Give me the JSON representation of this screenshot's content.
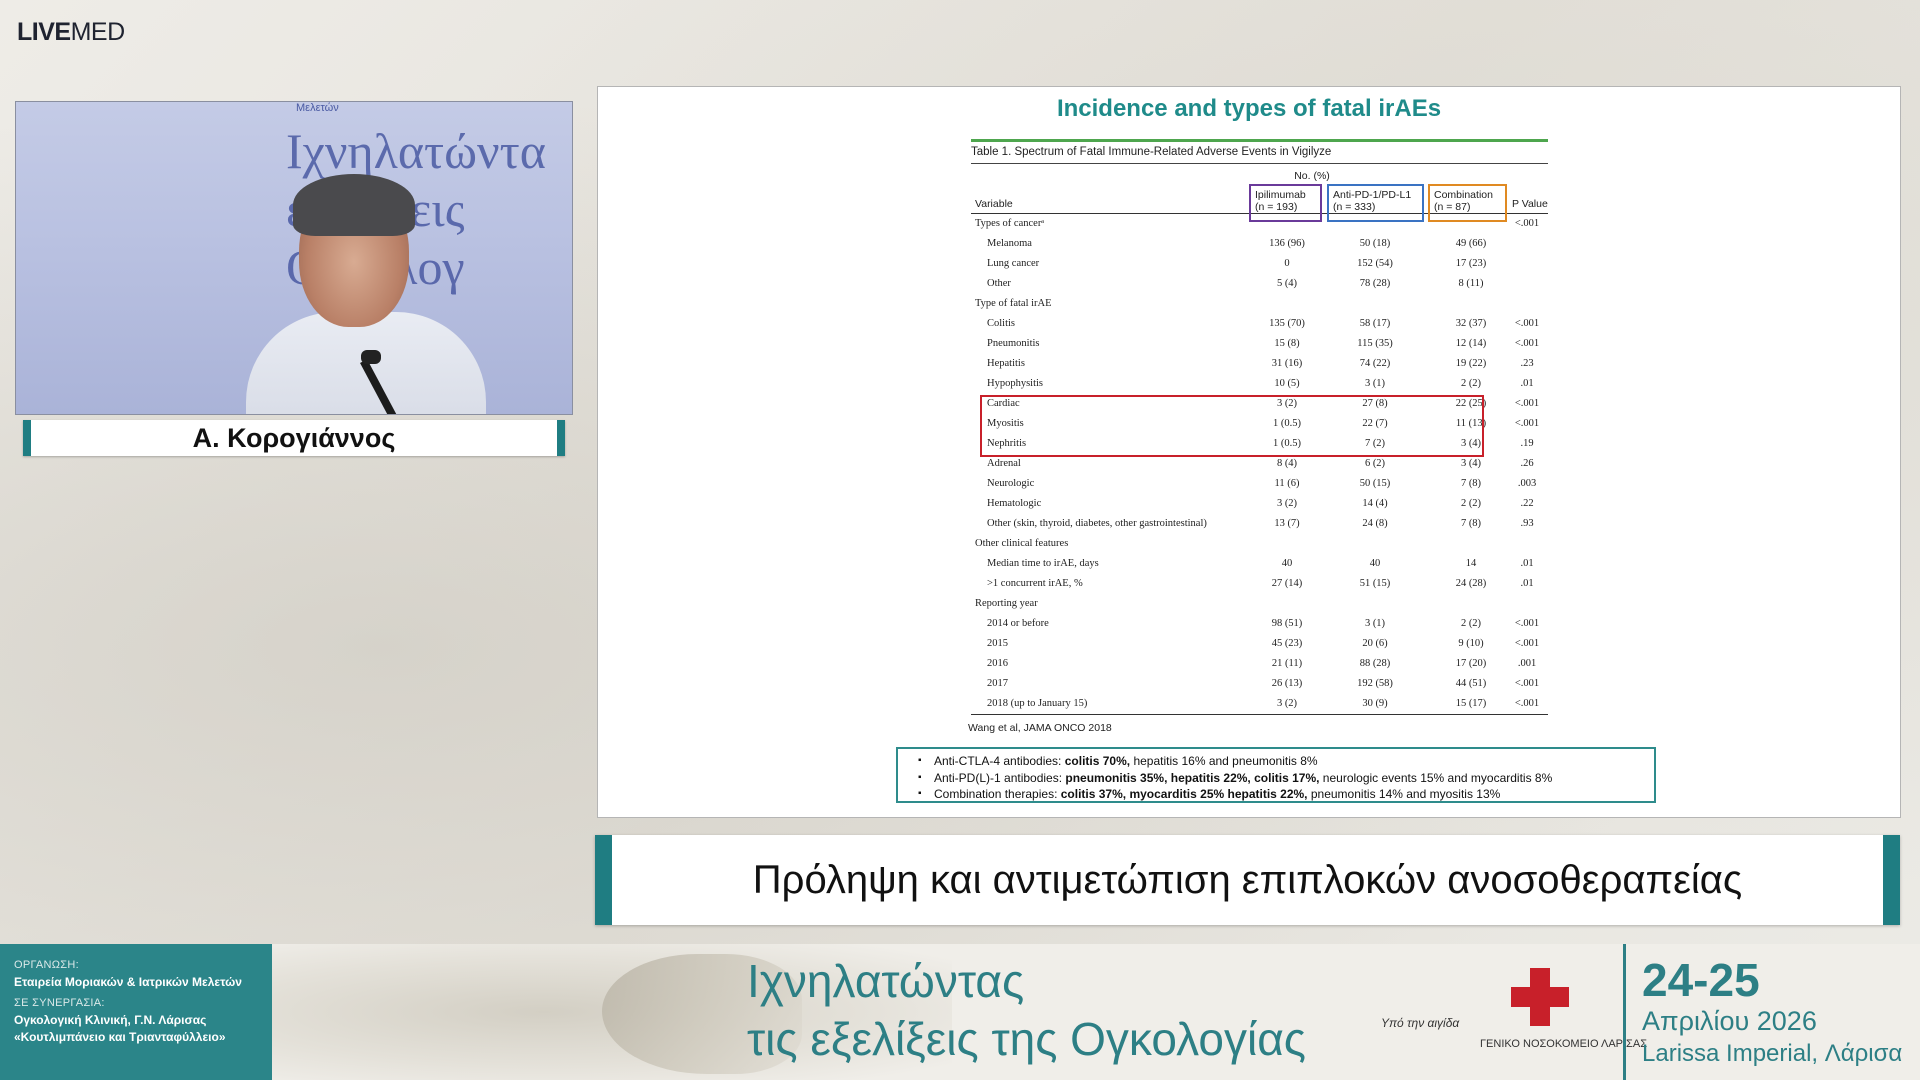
{
  "brand": {
    "logo_bold": "LIVE",
    "logo_light": "MED"
  },
  "video": {
    "banner_small": "Μελετών",
    "banner_lines": [
      "Ιχνηλατώντα",
      "εξελίξεις",
      "Ογκολογ"
    ],
    "speaker_name": "Α. Κορογιάννος"
  },
  "slide": {
    "title": "Incidence and types of fatal irAEs",
    "table_caption": "Table 1. Spectrum of Fatal Immune-Related Adverse Events in Vigilyze",
    "header": {
      "variable": "Variable",
      "n_percent": "No. (%)",
      "col1": [
        "Ipilimumab",
        "(n = 193)"
      ],
      "col2": [
        "Anti-PD-1/PD-L1",
        "(n = 333)"
      ],
      "col3": [
        "Combination",
        "(n = 87)"
      ],
      "pvalue": "P Value"
    },
    "rows": [
      {
        "label": "Types of cancerᵃ",
        "section": true,
        "c1": "",
        "c2": "",
        "c3": "",
        "p": "<.001"
      },
      {
        "label": "Melanoma",
        "c1": "136 (96)",
        "c2": "50 (18)",
        "c3": "49 (66)",
        "p": ""
      },
      {
        "label": "Lung cancer",
        "c1": "0",
        "c2": "152 (54)",
        "c3": "17 (23)",
        "p": ""
      },
      {
        "label": "Other",
        "c1": "5 (4)",
        "c2": "78 (28)",
        "c3": "8 (11)",
        "p": ""
      },
      {
        "label": "Type of fatal irAE",
        "section": true,
        "c1": "",
        "c2": "",
        "c3": "",
        "p": ""
      },
      {
        "label": "Colitis",
        "c1": "135 (70)",
        "c2": "58 (17)",
        "c3": "32 (37)",
        "p": "<.001"
      },
      {
        "label": "Pneumonitis",
        "c1": "15 (8)",
        "c2": "115 (35)",
        "c3": "12 (14)",
        "p": "<.001"
      },
      {
        "label": "Hepatitis",
        "c1": "31 (16)",
        "c2": "74 (22)",
        "c3": "19 (22)",
        "p": ".23"
      },
      {
        "label": "Hypophysitis",
        "c1": "10 (5)",
        "c2": "3 (1)",
        "c3": "2 (2)",
        "p": ".01"
      },
      {
        "label": "Cardiac",
        "c1": "3 (2)",
        "c2": "27 (8)",
        "c3": "22 (25)",
        "p": "<.001"
      },
      {
        "label": "Myositis",
        "c1": "1 (0.5)",
        "c2": "22 (7)",
        "c3": "11 (13)",
        "p": "<.001"
      },
      {
        "label": "Nephritis",
        "c1": "1 (0.5)",
        "c2": "7 (2)",
        "c3": "3 (4)",
        "p": ".19"
      },
      {
        "label": "Adrenal",
        "c1": "8 (4)",
        "c2": "6 (2)",
        "c3": "3 (4)",
        "p": ".26"
      },
      {
        "label": "Neurologic",
        "c1": "11 (6)",
        "c2": "50 (15)",
        "c3": "7 (8)",
        "p": ".003"
      },
      {
        "label": "Hematologic",
        "c1": "3 (2)",
        "c2": "14 (4)",
        "c3": "2 (2)",
        "p": ".22"
      },
      {
        "label": "Other (skin, thyroid, diabetes, other gastrointestinal)",
        "c1": "13 (7)",
        "c2": "24 (8)",
        "c3": "7 (8)",
        "p": ".93"
      },
      {
        "label": "Other clinical features",
        "section": true,
        "c1": "",
        "c2": "",
        "c3": "",
        "p": ""
      },
      {
        "label": "Median time to irAE, days",
        "c1": "40",
        "c2": "40",
        "c3": "14",
        "p": ".01"
      },
      {
        "label": ">1 concurrent irAE, %",
        "c1": "27 (14)",
        "c2": "51 (15)",
        "c3": "24 (28)",
        "p": ".01"
      },
      {
        "label": "Reporting year",
        "section": true,
        "c1": "",
        "c2": "",
        "c3": "",
        "p": ""
      },
      {
        "label": "2014 or before",
        "c1": "98 (51)",
        "c2": "3 (1)",
        "c3": "2 (2)",
        "p": "<.001"
      },
      {
        "label": "2015",
        "c1": "45 (23)",
        "c2": "20 (6)",
        "c3": "9 (10)",
        "p": "<.001"
      },
      {
        "label": "2016",
        "c1": "21 (11)",
        "c2": "88 (28)",
        "c3": "17 (20)",
        "p": ".001"
      },
      {
        "label": "2017",
        "c1": "26 (13)",
        "c2": "192 (58)",
        "c3": "44 (51)",
        "p": "<.001"
      },
      {
        "label": "2018 (up to January 15)",
        "c1": "3 (2)",
        "c2": "30 (9)",
        "c3": "15 (17)",
        "p": "<.001"
      }
    ],
    "citation": "Wang et al,  JAMA ONCO 2018",
    "summary": [
      {
        "prefix": "Anti-CTLA-4 antibodies: ",
        "bold": "colitis 70%,",
        "rest": " hepatitis 16% and pneumonitis 8%"
      },
      {
        "prefix": "Anti-PD(L)-1 antibodies: ",
        "bold": "pneumonitis 35%, hepatitis 22%, colitis 17%,",
        "rest": " neurologic events 15% and myocarditis 8%"
      },
      {
        "prefix": "Combination therapies: ",
        "bold": "colitis 37%, myocarditis 25% hepatitis 22%,",
        "rest": " pneumonitis 14% and myositis 13%"
      }
    ]
  },
  "topic": "Πρόληψη και αντιμετώπιση επιπλοκών ανοσοθεραπείας",
  "footer": {
    "org_label": "ΟΡΓΑΝΩΣΗ:",
    "org_value": "Εταιρεία Μοριακών & Ιατρικών Μελετών",
    "collab_label": "ΣΕ ΣΥΝΕΡΓΑΣΙΑ:",
    "collab_line1": "Ογκολογική Κλινική,  Γ.Ν. Λάρισας",
    "collab_line2": "«Κουτλιμπάνειο  και Τριανταφύλλειο»",
    "event_line1": "Ιχνηλατώντας",
    "event_line2_a": "τις ",
    "event_line2_b": "εξελίξεις",
    "event_line2_c": " της ",
    "event_line2_d": "Ογκολογίας",
    "patron": "Υπό την αιγίδα",
    "hospital": "ΓΕΝΙΚΟ ΝΟΣΟΚΟΜΕΙΟ ΛΑΡΙΣΑΣ",
    "dates": "24-25",
    "month": "Απριλίου 2026",
    "venue": "Larissa Imperial, Λάρισα"
  }
}
